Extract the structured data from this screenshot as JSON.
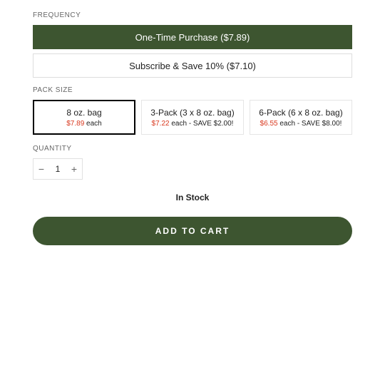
{
  "frequency": {
    "label": "FREQUENCY",
    "options": [
      {
        "text": "One-Time Purchase ($7.89)",
        "selected": true
      },
      {
        "text": "Subscribe & Save 10% ($7.10)",
        "selected": false
      }
    ]
  },
  "pack": {
    "label": "PACK SIZE",
    "options": [
      {
        "title": "8 oz. bag",
        "price": "$7.89",
        "extra": " each",
        "selected": true
      },
      {
        "title": "3-Pack (3 x 8 oz. bag)",
        "price": "$7.22",
        "extra": " each - SAVE $2.00!",
        "selected": false
      },
      {
        "title": "6-Pack (6 x 8 oz. bag)",
        "price": "$6.55",
        "extra": " each - SAVE $8.00!",
        "selected": false
      }
    ]
  },
  "quantity": {
    "label": "QUANTITY",
    "value": "1",
    "minus": "−",
    "plus": "+"
  },
  "stock": "In Stock",
  "add_to_cart": "ADD TO CART"
}
